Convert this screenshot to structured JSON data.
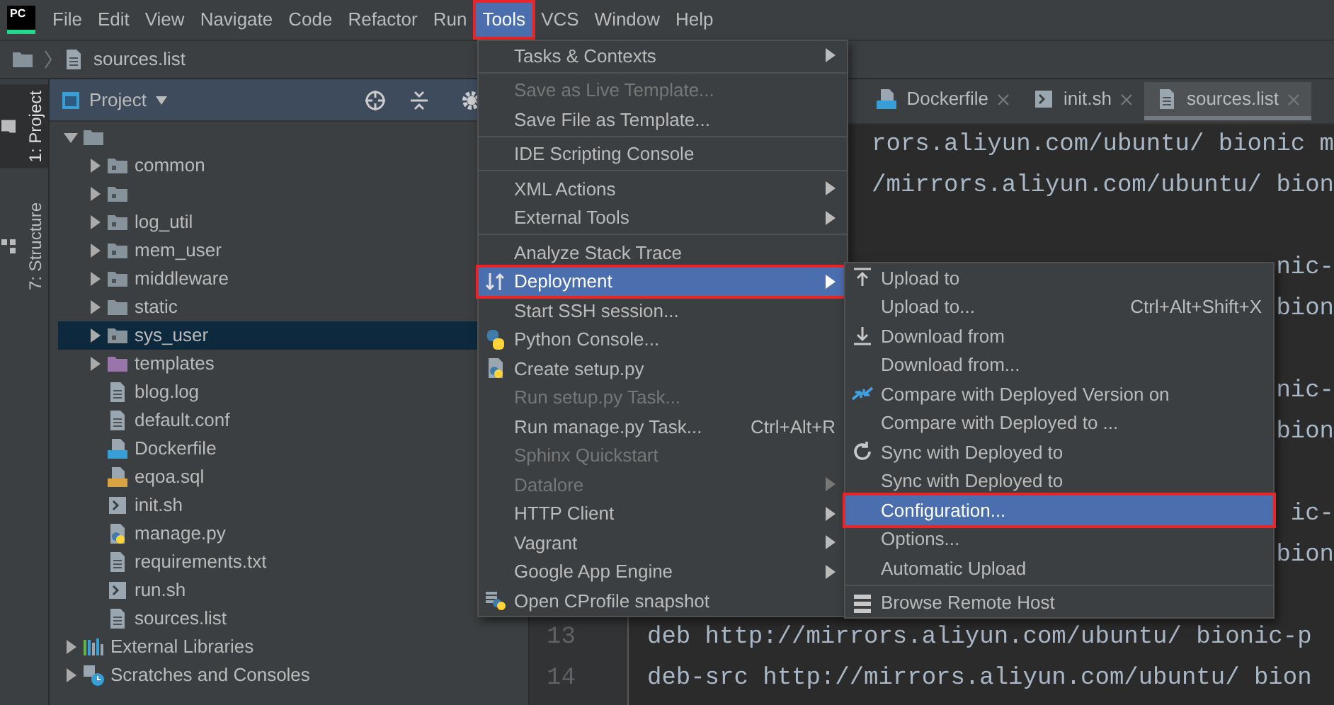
{
  "menubar": {
    "logo": "PC",
    "items": [
      {
        "label": "File",
        "selected": false,
        "highlighted": false
      },
      {
        "label": "Edit",
        "selected": false,
        "highlighted": false
      },
      {
        "label": "View",
        "selected": false,
        "highlighted": false
      },
      {
        "label": "Navigate",
        "selected": false,
        "highlighted": false
      },
      {
        "label": "Code",
        "selected": false,
        "highlighted": false
      },
      {
        "label": "Refactor",
        "selected": false,
        "highlighted": false
      },
      {
        "label": "Run",
        "selected": false,
        "highlighted": false
      },
      {
        "label": "Tools",
        "selected": true,
        "highlighted": true
      },
      {
        "label": "VCS",
        "selected": false,
        "highlighted": false
      },
      {
        "label": "Window",
        "selected": false,
        "highlighted": false
      },
      {
        "label": "Help",
        "selected": false,
        "highlighted": false
      }
    ]
  },
  "breadcrumb": {
    "file": "sources.list"
  },
  "tool_stripe": [
    {
      "label": "1: Project",
      "kind": "project",
      "selected": true
    },
    {
      "label": "7: Structure",
      "kind": "structure",
      "selected": false
    }
  ],
  "project_panel": {
    "title": "Project",
    "tree": [
      {
        "kind": "folder",
        "expanded": true,
        "selected": false,
        "children": [
          {
            "label": "common",
            "kind": "module",
            "expanded": false,
            "selected": false
          },
          {
            "kind": "module",
            "expanded": false,
            "selected": false
          },
          {
            "label": "log_util",
            "kind": "module",
            "expanded": false,
            "selected": false
          },
          {
            "label": "mem_user",
            "kind": "module",
            "expanded": false,
            "selected": false
          },
          {
            "label": "middleware",
            "kind": "module",
            "expanded": false,
            "selected": false
          },
          {
            "label": "static",
            "kind": "folder",
            "expanded": false,
            "selected": false
          },
          {
            "label": "sys_user",
            "kind": "module",
            "expanded": false,
            "selected": true
          },
          {
            "label": "templates",
            "kind": "templates",
            "expanded": false,
            "selected": false
          },
          {
            "label": "blog.log",
            "kind": "text",
            "selected": false
          },
          {
            "label": "default.conf",
            "kind": "text",
            "selected": false
          },
          {
            "label": "Dockerfile",
            "kind": "docker",
            "selected": false
          },
          {
            "label": "eqoa.sql",
            "kind": "sql",
            "selected": false
          },
          {
            "label": "init.sh",
            "kind": "shell",
            "selected": false
          },
          {
            "label": "manage.py",
            "kind": "python",
            "selected": false
          },
          {
            "label": "requirements.txt",
            "kind": "text",
            "selected": false
          },
          {
            "label": "run.sh",
            "kind": "shell",
            "selected": false
          },
          {
            "label": "sources.list",
            "kind": "text",
            "selected": false
          }
        ]
      },
      {
        "label": "External Libraries",
        "kind": "libraries",
        "expanded": false,
        "selected": false
      },
      {
        "label": "Scratches and Consoles",
        "kind": "scratches",
        "expanded": false,
        "selected": false
      }
    ]
  },
  "editor": {
    "tabs": [
      {
        "label": "Dockerfile",
        "kind": "docker",
        "selected": false
      },
      {
        "label": "init.sh",
        "kind": "shell",
        "selected": false
      },
      {
        "label": "sources.list",
        "kind": "text",
        "selected": true
      }
    ],
    "lines": [
      {
        "kind": "fragment",
        "text": "rors.aliyun.com/ubuntu/ bionic m"
      },
      {
        "kind": "fragment",
        "text": "/mirrors.aliyun.com/ubuntu/ bion"
      },
      {
        "kind": "blank"
      },
      {
        "kind": "fragment",
        "text": "nic-"
      },
      {
        "kind": "fragment",
        "text": "bion"
      },
      {
        "kind": "blank"
      },
      {
        "kind": "fragment",
        "text": "nic-"
      },
      {
        "kind": "fragment",
        "text": "bion"
      },
      {
        "kind": "blank"
      },
      {
        "kind": "fragment",
        "text": "ic-"
      },
      {
        "kind": "fragment",
        "text": "bion"
      },
      {
        "kind": "blank"
      },
      {
        "kind": "line",
        "number": "13",
        "text": "deb http://mirrors.aliyun.com/ubuntu/ bionic-p"
      },
      {
        "kind": "line",
        "number": "14",
        "text": "deb-src http://mirrors.aliyun.com/ubuntu/ bion"
      }
    ]
  },
  "tools_menu": {
    "items": [
      {
        "kind": "plain",
        "label": "Tasks & Contexts",
        "submenu": true,
        "disabled": false,
        "selected": false,
        "highlighted": false
      },
      {
        "kind": "separator"
      },
      {
        "kind": "plain",
        "label": "Save as Live Template...",
        "submenu": false,
        "disabled": true,
        "selected": false,
        "highlighted": false
      },
      {
        "kind": "plain",
        "label": "Save File as Template...",
        "submenu": false,
        "disabled": false,
        "selected": false,
        "highlighted": false
      },
      {
        "kind": "separator"
      },
      {
        "kind": "plain",
        "label": "IDE Scripting Console",
        "submenu": false,
        "disabled": false,
        "selected": false,
        "highlighted": false
      },
      {
        "kind": "separator"
      },
      {
        "kind": "plain",
        "label": "XML Actions",
        "submenu": true,
        "disabled": false,
        "selected": false,
        "highlighted": false
      },
      {
        "kind": "plain",
        "label": "External Tools",
        "submenu": true,
        "disabled": false,
        "selected": false,
        "highlighted": false
      },
      {
        "kind": "separator"
      },
      {
        "kind": "plain",
        "label": "Analyze Stack Trace",
        "submenu": false,
        "disabled": false,
        "selected": false,
        "highlighted": false
      },
      {
        "kind": "deployment",
        "label": "Deployment",
        "submenu": true,
        "disabled": false,
        "selected": true,
        "highlighted": true
      },
      {
        "kind": "plain",
        "label": "Start SSH session...",
        "submenu": false,
        "disabled": false,
        "selected": false,
        "highlighted": false
      },
      {
        "kind": "python",
        "label": "Python Console...",
        "submenu": false,
        "disabled": false,
        "selected": false,
        "highlighted": false
      },
      {
        "kind": "setup",
        "label": "Create setup.py",
        "submenu": false,
        "disabled": false,
        "selected": false,
        "highlighted": false
      },
      {
        "kind": "plain",
        "label": "Run setup.py Task...",
        "submenu": false,
        "disabled": true,
        "selected": false,
        "highlighted": false
      },
      {
        "kind": "plain",
        "label": "Run manage.py Task...",
        "shortcut": "Ctrl+Alt+R",
        "submenu": false,
        "disabled": false,
        "selected": false,
        "highlighted": false
      },
      {
        "kind": "plain",
        "label": "Sphinx Quickstart",
        "submenu": false,
        "disabled": true,
        "selected": false,
        "highlighted": false
      },
      {
        "kind": "plain",
        "label": "Datalore",
        "submenu": true,
        "disabled": true,
        "selected": false,
        "highlighted": false
      },
      {
        "kind": "plain",
        "label": "HTTP Client",
        "submenu": true,
        "disabled": false,
        "selected": false,
        "highlighted": false
      },
      {
        "kind": "plain",
        "label": "Vagrant",
        "submenu": true,
        "disabled": false,
        "selected": false,
        "highlighted": false
      },
      {
        "kind": "plain",
        "label": "Google App Engine",
        "submenu": true,
        "disabled": false,
        "selected": false,
        "highlighted": false
      },
      {
        "kind": "cprofile",
        "label": "Open CProfile snapshot",
        "submenu": false,
        "disabled": false,
        "selected": false,
        "highlighted": false
      }
    ]
  },
  "deployment_submenu": {
    "items": [
      {
        "kind": "upload",
        "label": "Upload to",
        "submenu": false,
        "disabled": false,
        "selected": false,
        "highlighted": false
      },
      {
        "kind": "plain",
        "label": "Upload to...",
        "shortcut": "Ctrl+Alt+Shift+X",
        "submenu": false,
        "disabled": false,
        "selected": false,
        "highlighted": false
      },
      {
        "kind": "download",
        "label": "Download from",
        "submenu": false,
        "disabled": false,
        "selected": false,
        "highlighted": false
      },
      {
        "kind": "plain",
        "label": "Download from...",
        "submenu": false,
        "disabled": false,
        "selected": false,
        "highlighted": false
      },
      {
        "kind": "compare",
        "label": "Compare with Deployed Version on",
        "submenu": false,
        "disabled": false,
        "selected": false,
        "highlighted": false
      },
      {
        "kind": "plain",
        "label": "Compare with Deployed to ...",
        "submenu": false,
        "disabled": false,
        "selected": false,
        "highlighted": false
      },
      {
        "kind": "sync",
        "label": "Sync with Deployed to",
        "submenu": false,
        "disabled": false,
        "selected": false,
        "highlighted": false
      },
      {
        "kind": "plain",
        "label": "Sync with Deployed to",
        "submenu": false,
        "disabled": false,
        "selected": false,
        "highlighted": false
      },
      {
        "kind": "plain",
        "label": "Configuration...",
        "submenu": false,
        "disabled": false,
        "selected": true,
        "highlighted": true
      },
      {
        "kind": "plain",
        "label": "Options...",
        "submenu": false,
        "disabled": false,
        "selected": false,
        "highlighted": false
      },
      {
        "kind": "plain",
        "label": "Automatic Upload",
        "submenu": false,
        "disabled": false,
        "selected": false,
        "highlighted": false
      },
      {
        "kind": "separator"
      },
      {
        "kind": "host",
        "label": "Browse Remote Host",
        "submenu": false,
        "disabled": false,
        "selected": false,
        "highlighted": false
      }
    ]
  }
}
